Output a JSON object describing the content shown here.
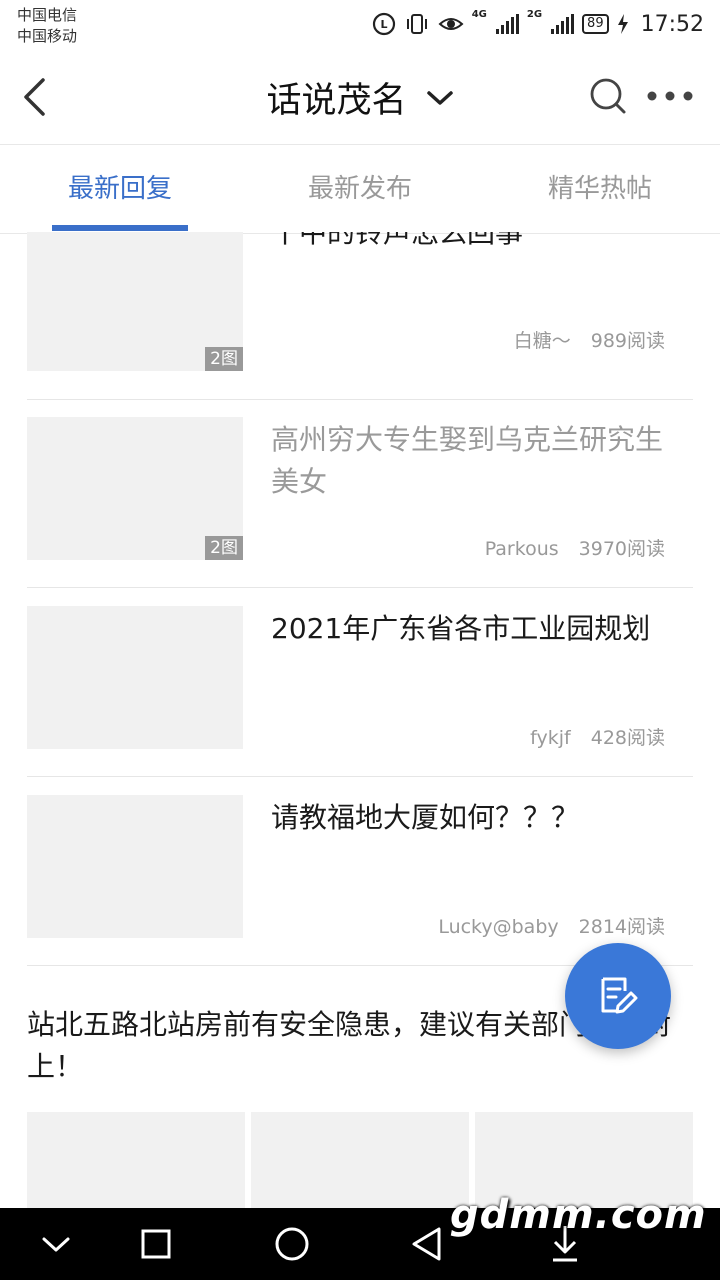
{
  "status_bar": {
    "carrier_1": "中国电信",
    "carrier_2": "中国移动",
    "net_1": "4G",
    "net_2": "2G",
    "battery": "89",
    "time": "17:52",
    "icons": [
      "hd-call-icon",
      "vibrate-icon",
      "eye-icon",
      "signal-icon",
      "battery-icon",
      "charging-icon"
    ]
  },
  "header": {
    "title": "话说茂名",
    "icons": [
      "back-icon",
      "chevron-down-icon",
      "search-icon",
      "more-icon"
    ]
  },
  "tabs": [
    {
      "label": "最新回复",
      "active": true
    },
    {
      "label": "最新发布",
      "active": false
    },
    {
      "label": "精华热帖",
      "active": false
    }
  ],
  "posts": [
    {
      "title": "十中的铃声怎么回事",
      "author": "白糖～",
      "views": "989阅读",
      "image_count": "2图",
      "read": false
    },
    {
      "title": "高州穷大专生娶到乌克兰研究生美女",
      "author": "Parkous",
      "views": "3970阅读",
      "image_count": "2图",
      "read": true
    },
    {
      "title": "2021年广东省各市工业园规划",
      "author": "fykjf",
      "views": "428阅读",
      "image_count": "",
      "read": false
    },
    {
      "title": "请教福地大厦如何？？？",
      "author": "Lucky@baby",
      "views": "2814阅读",
      "image_count": "",
      "read": false
    },
    {
      "title": "站北五路北站房前有安全隐患，建议有关部门马上封上！"
    }
  ],
  "fab": {
    "icon": "edit-icon"
  },
  "nav_bar": {
    "icons": [
      "hide-icon",
      "recent-apps-icon",
      "home-icon",
      "back-nav-icon",
      "notification-pull-icon"
    ]
  },
  "watermark": "gdmm.com",
  "colors": {
    "accent": "#3a6fc9",
    "fab": "#3a78d8",
    "muted": "#999999"
  }
}
